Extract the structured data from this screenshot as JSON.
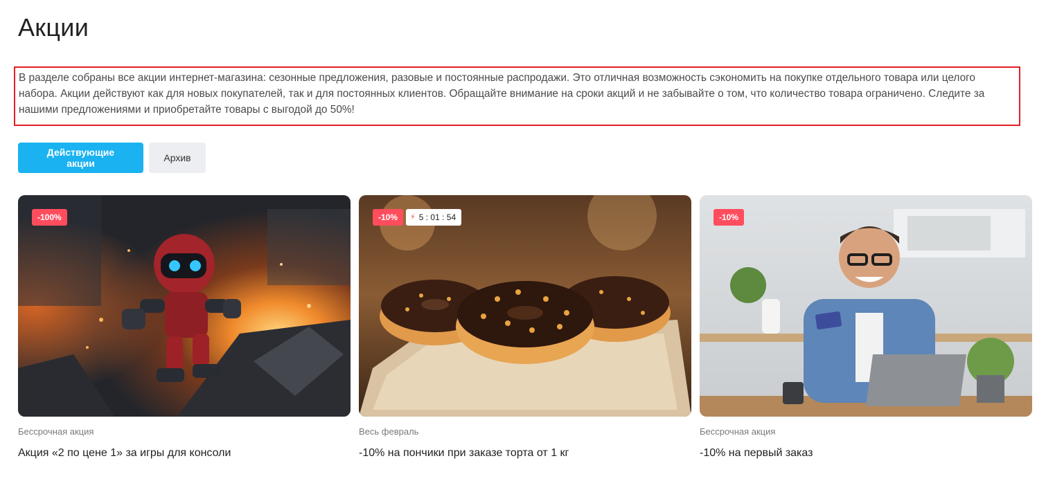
{
  "page": {
    "title": "Акции",
    "intro": "В разделе собраны все акции интернет-магазина: сезонные предложения, разовые и постоянные распродажи. Это отличная возможность сэкономить на покупке отдельного товара или целого набора. Акции действуют как для новых покупателей, так и для постоянных клиентов. Обращайте внимание на сроки акций и не забывайте о том, что количество товара ограничено. Следите за нашими предложениями и приобретайте товары с выгодой до 50%!"
  },
  "tabs": {
    "active_label": "Действующие акции",
    "archive_label": "Архив"
  },
  "cards": [
    {
      "discount": "-100%",
      "period": "Бессрочная акция",
      "title": "Акция «2 по цене 1» за игры для консоли",
      "image": "robot-explosion-image"
    },
    {
      "discount": "-10%",
      "timer": "5 : 01 : 54",
      "timer_icon": "bolt-icon",
      "period": "Весь февраль",
      "title": "-10% на пончики при заказе торта от 1 кг",
      "image": "donuts-image"
    },
    {
      "discount": "-10%",
      "period": "Бессрочная акция",
      "title": "-10% на первый заказ",
      "image": "man-with-card-image"
    }
  ],
  "colors": {
    "accent": "#1ab2f0",
    "badge": "#ff4d5e",
    "highlight_border": "#e31e24"
  }
}
